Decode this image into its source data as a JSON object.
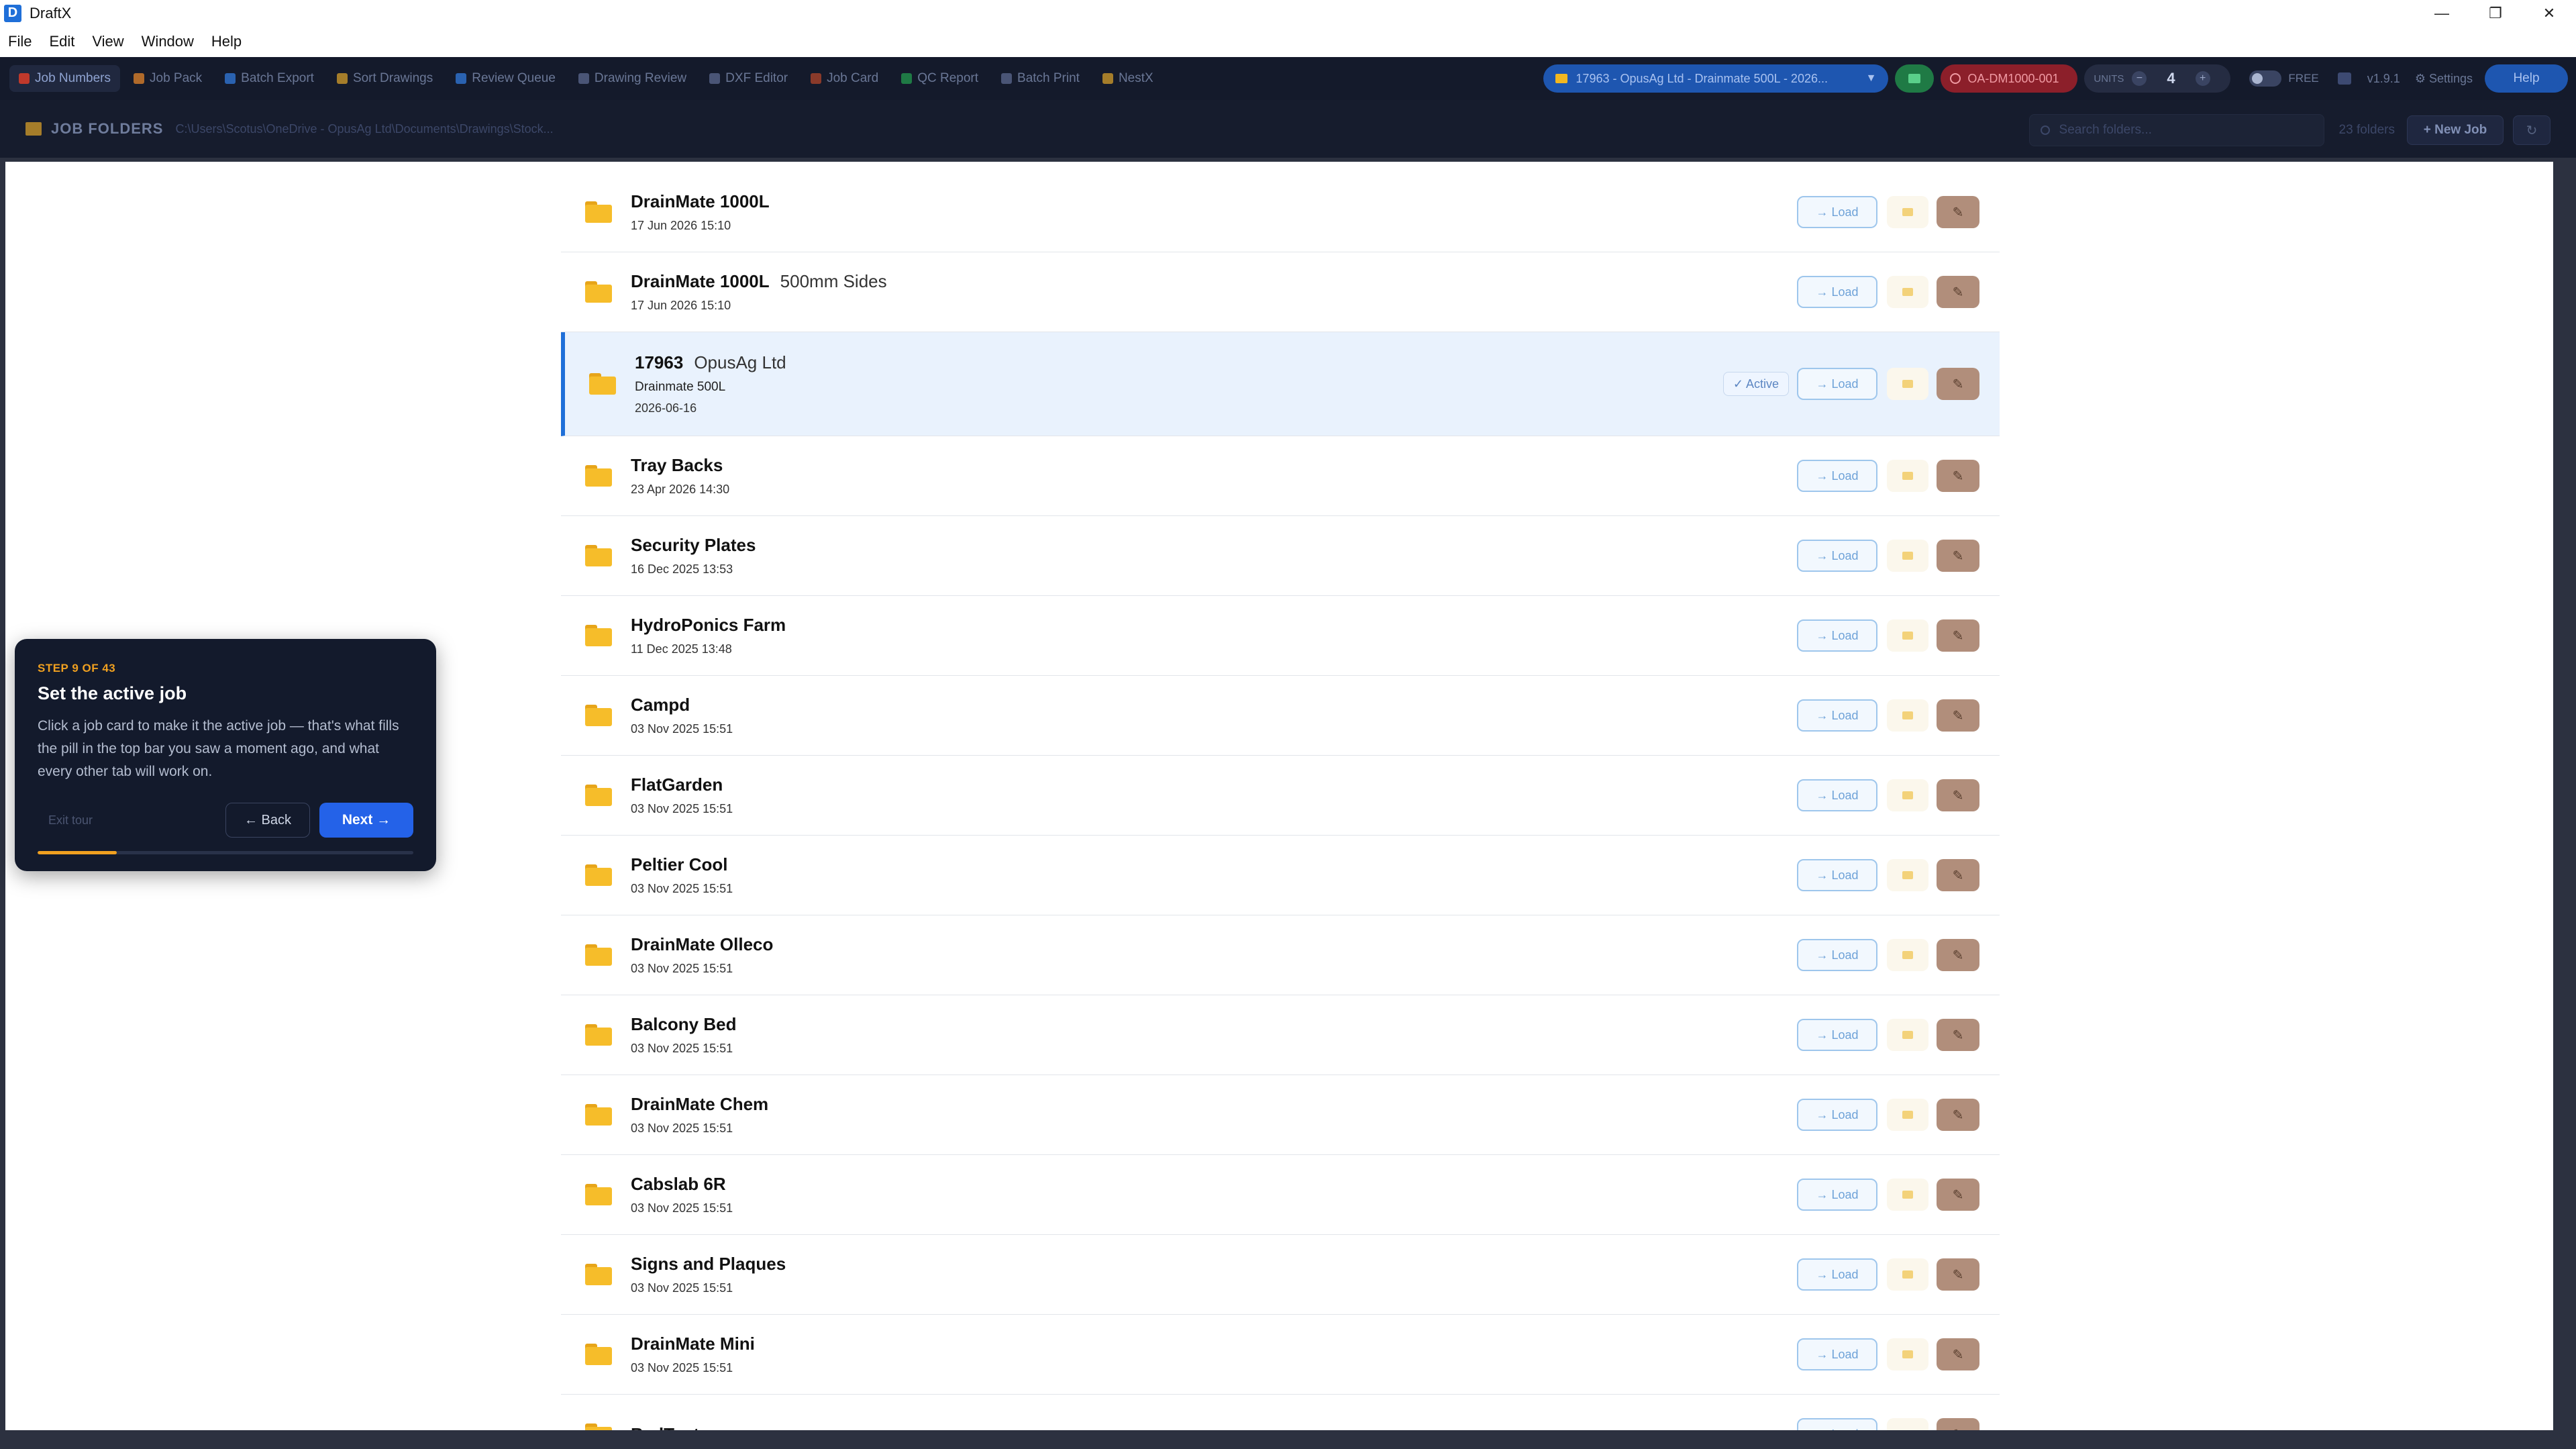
{
  "window": {
    "app_icon_letter": "D",
    "title": "DraftX",
    "controls": {
      "minimize": "—",
      "restore": "❐",
      "close": "✕"
    }
  },
  "menu": [
    "File",
    "Edit",
    "View",
    "Window",
    "Help"
  ],
  "toolbar": {
    "tabs": [
      {
        "label": "Job Numbers",
        "icon": "clipboard-icon",
        "color": "#c0392b"
      },
      {
        "label": "Job Pack",
        "icon": "package-icon",
        "color": "#b06a2a"
      },
      {
        "label": "Batch Export",
        "icon": "export-icon",
        "color": "#2a62b0"
      },
      {
        "label": "Sort Drawings",
        "icon": "folder-icon",
        "color": "#a57d2a"
      },
      {
        "label": "Review Queue",
        "icon": "search-icon",
        "color": "#2a62b0"
      },
      {
        "label": "Drawing Review",
        "icon": "review-icon",
        "color": "#4a5576"
      },
      {
        "label": "DXF Editor",
        "icon": "pencil-icon",
        "color": "#4a5576"
      },
      {
        "label": "Job Card",
        "icon": "card-icon",
        "color": "#8a3a2a"
      },
      {
        "label": "QC Report",
        "icon": "check-icon",
        "color": "#1f7a45"
      },
      {
        "label": "Batch Print",
        "icon": "printer-icon",
        "color": "#4a5576"
      },
      {
        "label": "NestX",
        "icon": "nest-icon",
        "color": "#a57d2a"
      }
    ],
    "job_pill": "17963 - OpusAg Ltd - Drainmate 500L - 2026...",
    "job_pill_chevron": "▼",
    "part_pill": "OA-DM1000-001",
    "units_label": "UNITS",
    "units_minus": "−",
    "units_value": "4",
    "units_plus": "+",
    "free_label": "FREE",
    "version": "v1.9.1",
    "settings": "⚙ Settings",
    "help": "Help"
  },
  "folders_header": {
    "title": "JOB FOLDERS",
    "path": "C:\\Users\\Scotus\\OneDrive - OpusAg Ltd\\Documents\\Drawings\\Stock...",
    "search_placeholder": "Search folders...",
    "count": "23 folders",
    "new_job": "+ New Job",
    "refresh": "↻"
  },
  "jobs": [
    {
      "name": "DrainMate 1000L",
      "sub": "",
      "date": "17 Jun 2026 15:10"
    },
    {
      "name": "DrainMate 1000L",
      "sub": "500mm Sides",
      "date": "17 Jun 2026 15:10"
    },
    {
      "name": "17963",
      "sub": "OpusAg Ltd",
      "extra": "Drainmate 500L",
      "date": "2026-06-16",
      "active": true
    },
    {
      "name": "Tray Backs",
      "sub": "",
      "date": "23 Apr 2026 14:30"
    },
    {
      "name": "Security Plates",
      "sub": "",
      "date": "16 Dec 2025 13:53"
    },
    {
      "name": "HydroPonics Farm",
      "sub": "",
      "date": "11 Dec 2025 13:48"
    },
    {
      "name": "Campd",
      "sub": "",
      "date": "03 Nov 2025 15:51"
    },
    {
      "name": "FlatGarden",
      "sub": "",
      "date": "03 Nov 2025 15:51"
    },
    {
      "name": "Peltier Cool",
      "sub": "",
      "date": "03 Nov 2025 15:51"
    },
    {
      "name": "DrainMate Olleco",
      "sub": "",
      "date": "03 Nov 2025 15:51"
    },
    {
      "name": "Balcony Bed",
      "sub": "",
      "date": "03 Nov 2025 15:51"
    },
    {
      "name": "DrainMate Chem",
      "sub": "",
      "date": "03 Nov 2025 15:51"
    },
    {
      "name": "Cabslab 6R",
      "sub": "",
      "date": "03 Nov 2025 15:51"
    },
    {
      "name": "Signs and Plaques",
      "sub": "",
      "date": "03 Nov 2025 15:51"
    },
    {
      "name": "DrainMate Mini",
      "sub": "",
      "date": "03 Nov 2025 15:51"
    },
    {
      "name": "BedTent",
      "sub": "",
      "date": ""
    }
  ],
  "card_labels": {
    "load": "→ Load",
    "active": "✓ Active",
    "edit": "✎"
  },
  "tour": {
    "step": "STEP 9 OF 43",
    "title": "Set the active job",
    "body": "Click a job card to make it the active job — that's what fills the pill in the top bar you saw a moment ago, and what every other tab will work on.",
    "exit": "Exit tour",
    "back": "← Back",
    "next": "Next →",
    "progress": 0.21
  }
}
